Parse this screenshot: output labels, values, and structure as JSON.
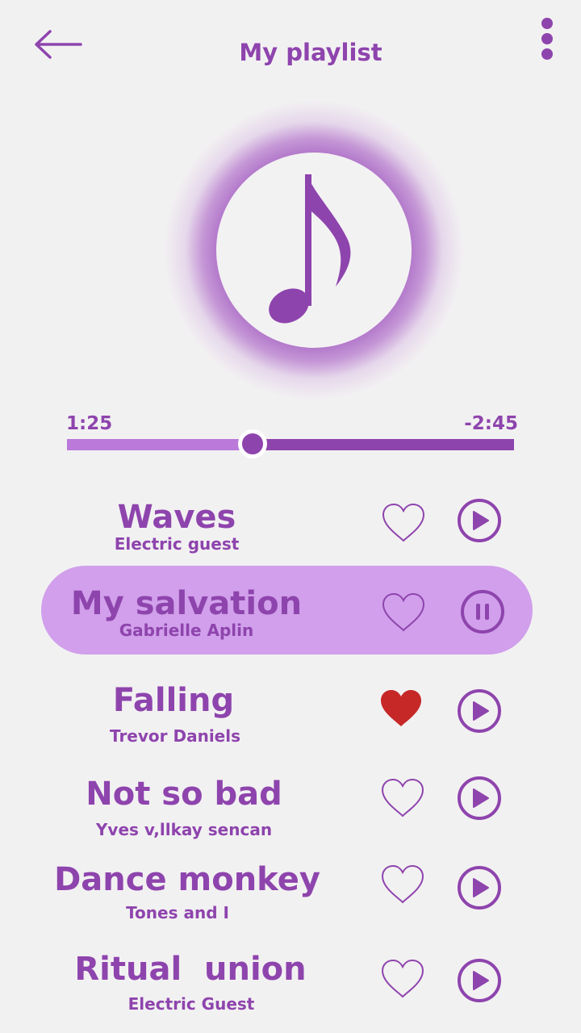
{
  "header": {
    "title": "My playlist",
    "back_icon": "arrow-left-icon",
    "menu_icon": "more-vertical-icon"
  },
  "album_art": {
    "icon": "music-note-icon"
  },
  "player": {
    "elapsed": "1:25",
    "remaining": "-2:45",
    "progress": 0.41
  },
  "colors": {
    "accent": "#8e44ad",
    "accent_light": "#bb79da",
    "active_row": "#d19feb",
    "liked_heart": "#c62828",
    "background": "#f2f1f2"
  },
  "songs": [
    {
      "title": "Waves",
      "artist": "Electric guest",
      "liked": false,
      "state": "play"
    },
    {
      "title": "My salvation",
      "artist": "Gabrielle Aplin",
      "liked": false,
      "state": "pause",
      "active": true
    },
    {
      "title": "Falling",
      "artist": "Trevor Daniels",
      "liked": true,
      "state": "play"
    },
    {
      "title": "Not so bad",
      "artist": "Yves v,llkay sencan",
      "liked": false,
      "state": "play"
    },
    {
      "title": "Dance monkey",
      "artist": "Tones and I",
      "liked": false,
      "state": "play"
    },
    {
      "title": "Ritual  union",
      "artist": "Electric Guest",
      "liked": false,
      "state": "play"
    }
  ]
}
